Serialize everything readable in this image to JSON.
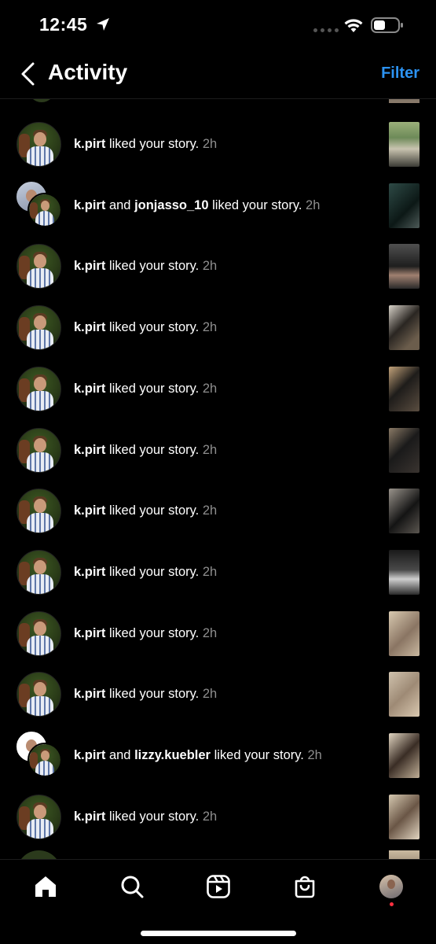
{
  "status_bar": {
    "time": "12:45",
    "icons": [
      "location-arrow-icon",
      "signal-dots-icon",
      "wifi-icon",
      "battery-icon"
    ]
  },
  "header": {
    "title": "Activity",
    "filter_label": "Filter",
    "accent_color": "#2c93f2"
  },
  "activity": {
    "items": [
      {
        "user": "k.pirt",
        "connector": "",
        "other_user": "",
        "action": "liked your story.",
        "time": "2h",
        "avatar": "single",
        "thumb": "road"
      },
      {
        "user": "k.pirt",
        "connector": "and",
        "other_user": "jonjasso_10",
        "action": "liked your story.",
        "time": "2h",
        "avatar": "double",
        "thumb": "dark-teal"
      },
      {
        "user": "k.pirt",
        "connector": "",
        "other_user": "",
        "action": "liked your story.",
        "time": "2h",
        "avatar": "single",
        "thumb": "gym"
      },
      {
        "user": "k.pirt",
        "connector": "",
        "other_user": "",
        "action": "liked your story.",
        "time": "2h",
        "avatar": "single",
        "thumb": "desk"
      },
      {
        "user": "k.pirt",
        "connector": "",
        "other_user": "",
        "action": "liked your story.",
        "time": "2h",
        "avatar": "single",
        "thumb": "bag"
      },
      {
        "user": "k.pirt",
        "connector": "",
        "other_user": "",
        "action": "liked your story.",
        "time": "2h",
        "avatar": "single",
        "thumb": "bag-dark"
      },
      {
        "user": "k.pirt",
        "connector": "",
        "other_user": "",
        "action": "liked your story.",
        "time": "2h",
        "avatar": "single",
        "thumb": "shoes"
      },
      {
        "user": "k.pirt",
        "connector": "",
        "other_user": "",
        "action": "liked your story.",
        "time": "2h",
        "avatar": "single",
        "thumb": "screen"
      },
      {
        "user": "k.pirt",
        "connector": "",
        "other_user": "",
        "action": "liked your story.",
        "time": "2h",
        "avatar": "single",
        "thumb": "room"
      },
      {
        "user": "k.pirt",
        "connector": "",
        "other_user": "",
        "action": "liked your story.",
        "time": "2h",
        "avatar": "single",
        "thumb": "room2"
      },
      {
        "user": "k.pirt",
        "connector": "and",
        "other_user": "lizzy.kuebler",
        "action": "liked your story.",
        "time": "2h",
        "avatar": "double-white",
        "thumb": "room3"
      },
      {
        "user": "k.pirt",
        "connector": "",
        "other_user": "",
        "action": "liked your story.",
        "time": "2h",
        "avatar": "single",
        "thumb": "room4"
      }
    ]
  },
  "tabbar": {
    "tabs": [
      "home-icon",
      "search-icon",
      "reels-icon",
      "shop-icon",
      "profile-avatar"
    ],
    "notification_color": "#ff3040"
  }
}
